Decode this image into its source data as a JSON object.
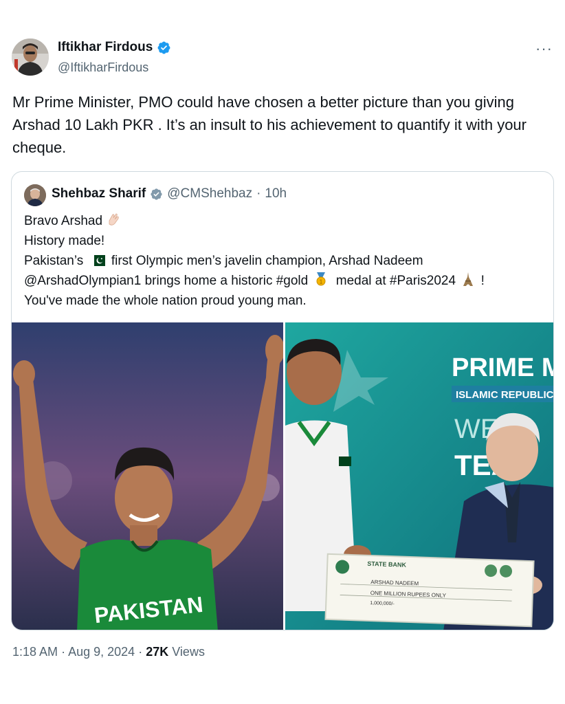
{
  "author": {
    "name": "Iftikhar Firdous",
    "handle": "@IftikharFirdous",
    "more_label": "···"
  },
  "tweet_text": "Mr Prime Minister,  PMO could have chosen a better picture than you giving Arshad 10 Lakh PKR . It’s an insult to his achievement to quantify it with your cheque.",
  "quoted": {
    "name": "Shehbaz Sharif",
    "handle": "@CMShehbaz",
    "separator": "·",
    "time": "10h",
    "line1": "Bravo Arshad",
    "line2": "History made!",
    "line3a": "Pakistan’s",
    "line3b": "first Olympic men’s javelin champion, Arshad Nadeem",
    "line4a": "@ArshadOlympian1 brings home a historic #gold",
    "line4b": "medal at #Paris2024",
    "line4c": "!",
    "line5": "You've made the whole nation proud young man.",
    "jersey_text": "PAKISTAN",
    "banner_line1": "PRIME MI",
    "banner_line2": "ISLAMIC REPUBLIC",
    "banner_line3": "WELC",
    "banner_line4": "TEA",
    "cheque_bank": "STATE BANK",
    "cheque_payee": "ARSHAD NADEEM",
    "cheque_amount_words": "ONE MILLION RUPEES ONLY",
    "cheque_amount": "1,000,000/-"
  },
  "footer": {
    "time": "1:18 AM",
    "sep1": "·",
    "date": "Aug 9, 2024",
    "sep2": "·",
    "views_count": "27K",
    "views_label": "Views"
  },
  "colors": {
    "verified_blue": "#1d9bf0",
    "secondary_text": "#536471",
    "border": "#cfd9de"
  },
  "icons": [
    "verified-badge-icon",
    "grey-verified-badge-icon",
    "more-options-icon",
    "clapping-hands-emoji",
    "pakistan-flag-emoji",
    "gold-medal-emoji",
    "eiffel-tower-emoji"
  ]
}
